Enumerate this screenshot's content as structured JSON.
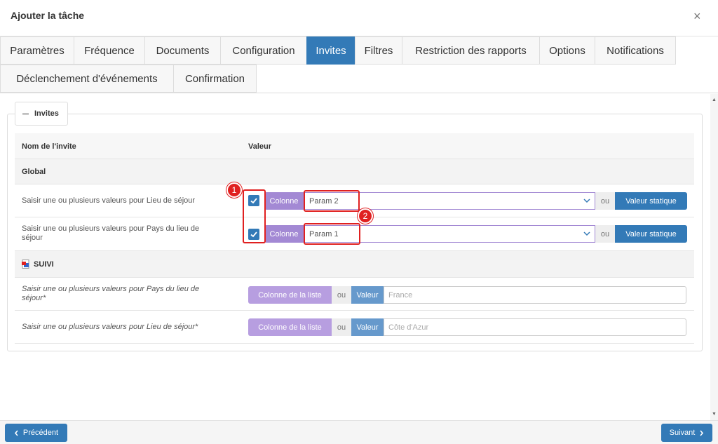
{
  "dialog": {
    "title": "Ajouter la tâche",
    "close_icon": "×"
  },
  "tabs": [
    {
      "label": "Paramètres",
      "active": false
    },
    {
      "label": "Fréquence",
      "active": false
    },
    {
      "label": "Documents",
      "active": false
    },
    {
      "label": "Configuration",
      "active": false
    },
    {
      "label": "Invites",
      "active": true
    },
    {
      "label": "Filtres",
      "active": false
    },
    {
      "label": "Restriction des rapports",
      "active": false
    },
    {
      "label": "Options",
      "active": false
    },
    {
      "label": "Notifications",
      "active": false
    },
    {
      "label": "Déclenchement d'événements",
      "active": false
    },
    {
      "label": "Confirmation",
      "active": false
    }
  ],
  "section": {
    "toggle_label": "Invites"
  },
  "table": {
    "header": {
      "name": "Nom de l'invite",
      "value": "Valeur"
    },
    "global_label": "Global",
    "global_rows": [
      {
        "label": "Saisir une ou plusieurs valeurs pour Lieu de séjour",
        "checked": true,
        "column_button": "Colonne",
        "selected": "Param 2",
        "or": "ou",
        "static_button": "Valeur statique"
      },
      {
        "label": "Saisir une ou plusieurs valeurs pour Pays du lieu de séjour",
        "checked": true,
        "column_button": "Colonne",
        "selected": "Param 1",
        "or": "ou",
        "static_button": "Valeur statique"
      }
    ],
    "suivi_label": "SUIVI",
    "suivi_rows": [
      {
        "label": "Saisir une ou plusieurs valeurs pour Pays du lieu de séjour*",
        "list_button": "Colonne de la liste",
        "or": "ou",
        "value_button": "Valeur",
        "placeholder": "France"
      },
      {
        "label": "Saisir une ou plusieurs valeurs pour Lieu de séjour*",
        "list_button": "Colonne de la liste",
        "or": "ou",
        "value_button": "Valeur",
        "placeholder": "Côte d'Azur"
      }
    ]
  },
  "annotations": [
    {
      "number": "1"
    },
    {
      "number": "2"
    }
  ],
  "footer": {
    "previous": "Précédent",
    "next": "Suivant"
  },
  "colors": {
    "primary": "#337ab7",
    "purple": "#a389d4",
    "annotation": "#e02020"
  }
}
